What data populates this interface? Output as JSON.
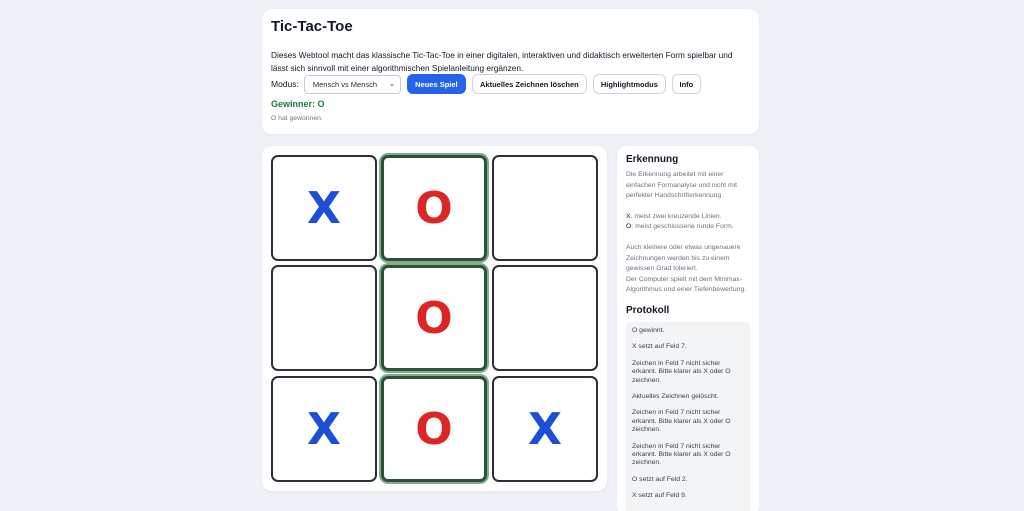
{
  "header": {
    "title": "Tic-Tac-Toe",
    "description": "Dieses Webtool macht das klassische Tic-Tac-Toe in einer digitalen, interaktiven und didaktisch erweiterten Form spielbar und lässt sich sinnvoll mit einer algorithmischen Spielanleitung ergänzen.",
    "mode_label": "Modus:",
    "mode_value": "Mensch vs Mensch",
    "buttons": {
      "new_game": "Neues Spiel",
      "clear_drawing": "Aktuelles Zeichnen löschen",
      "highlight": "Highlightmodus",
      "info": "Info"
    },
    "winner": "Gewinner: O",
    "status": "O hat gewonnen."
  },
  "board": {
    "cells": [
      "X",
      "O",
      "",
      "",
      "O",
      "",
      "X",
      "O",
      "X"
    ],
    "winning_cells": [
      2,
      5,
      8
    ]
  },
  "colors": {
    "primary": "#2563eb",
    "x_mark": "#1d4ed8",
    "o_mark": "#dc2626",
    "winner_text": "#15803d"
  },
  "recognition": {
    "heading": "Erkennung",
    "intro": "Die Erkennung arbeitet mit einer einfachen Formanalyse und nicht mit perfekter Handschrifterkennung.",
    "x_key": "X",
    "x_desc": ": meist zwei kreuzende Linien.",
    "o_key": "O",
    "o_desc": ": meist geschlossene runde Form.",
    "note1": "Auch kleinere oder etwas ungenauere Zeichnungen werden bis zu einem gewissen Grad toleriert.",
    "note2": "Der Computer spielt mit dem Minimax-Algorithmus und einer Tiefenbewertung."
  },
  "protocol": {
    "heading": "Protokoll",
    "entries": [
      "O gewinnt.",
      "X setzt auf Feld 7.",
      "Zeichen in Feld 7 nicht sicher erkannt. Bitte klarer als X oder O zeichnen.",
      "Aktuelles Zeichnen gelöscht.",
      "Zeichen in Feld 7 nicht sicher erkannt. Bitte klarer als X oder O zeichnen.",
      "Zeichen in Feld 7 nicht sicher erkannt. Bitte klarer als X oder O zeichnen.",
      "O setzt auf Feld 2.",
      "X setzt auf Feld 9."
    ]
  }
}
